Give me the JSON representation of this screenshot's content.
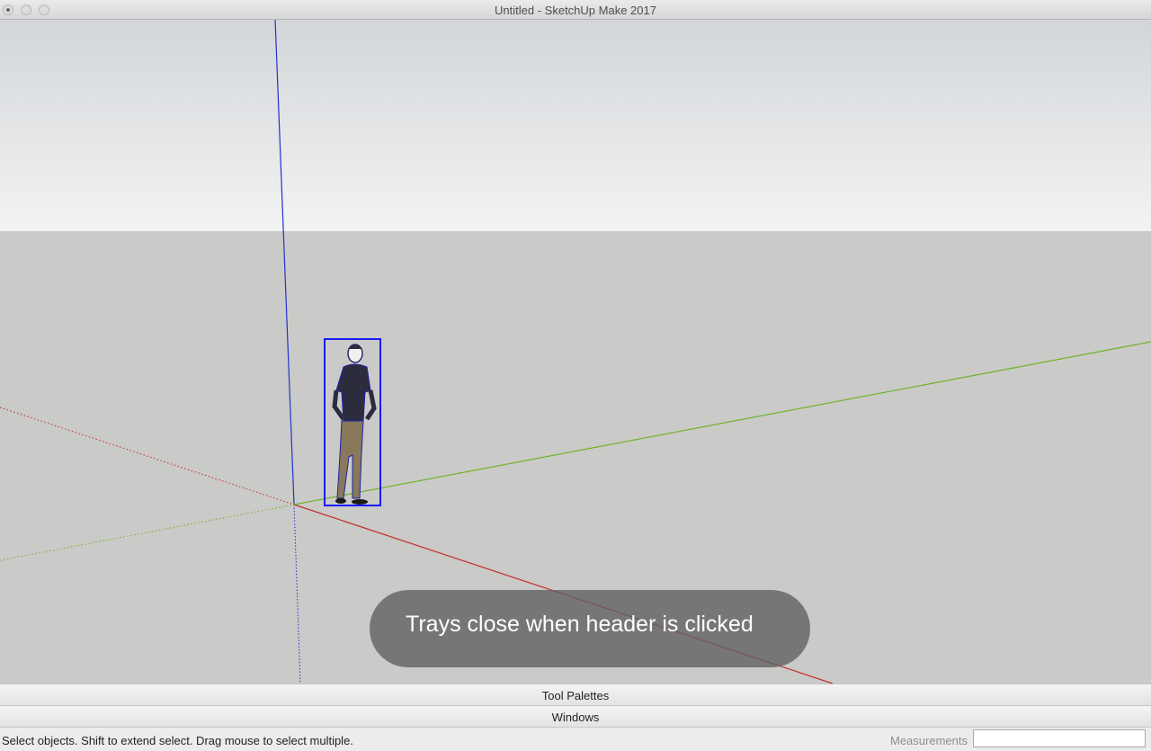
{
  "window": {
    "title": "Untitled - SketchUp Make 2017"
  },
  "viewport": {
    "toast_text": "Trays close when header is clicked",
    "colors": {
      "sky_top": "#d3d6d9",
      "sky_bottom": "#f2f3f4",
      "ground": "#cacac8",
      "red_axis": "#c0302a",
      "green_axis": "#6fb325",
      "blue_axis": "#2432cc",
      "selection": "#1a1aff"
    }
  },
  "trays": [
    {
      "label": "Tool Palettes"
    },
    {
      "label": "Windows"
    }
  ],
  "statusbar": {
    "hint": "Select objects. Shift to extend select. Drag mouse to select multiple.",
    "measurements_label": "Measurements",
    "measurements_value": ""
  }
}
